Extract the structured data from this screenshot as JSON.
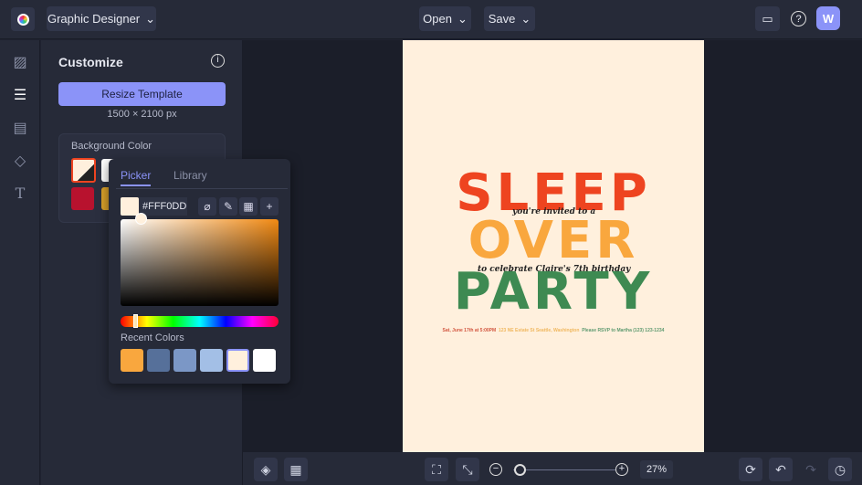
{
  "app": {
    "title": "Graphic Designer",
    "open": "Open",
    "save": "Save",
    "avatar": "W"
  },
  "panel": {
    "title": "Customize",
    "resize": "Resize Template",
    "dims": "1500 × 2100 px",
    "bg_label": "Background Color"
  },
  "picker": {
    "tabs": [
      "Picker",
      "Library"
    ],
    "hex": "#FFF0DD",
    "recent_label": "Recent Colors",
    "recent": [
      "#f9a73e",
      "#56709a",
      "#7b97c6",
      "#a3bfe6",
      "#fff0dd",
      "#ffffff"
    ]
  },
  "poster": {
    "line1": "SLEEP",
    "line2": "OVER",
    "line3": "PARTY",
    "invited": "you're invited to a",
    "celebrate": "to celebrate Claire's 7th birthday",
    "date": "Sat, June 17th at 5:00PM",
    "address": "123 NE Estate St Seattle, Washington",
    "rsvp": "Please RSVP to Martha (123) 123-1234",
    "colors": {
      "sleep": "#ee4420",
      "over": "#f9a73e",
      "party": "#3e8a52"
    }
  },
  "zoom": "27%"
}
